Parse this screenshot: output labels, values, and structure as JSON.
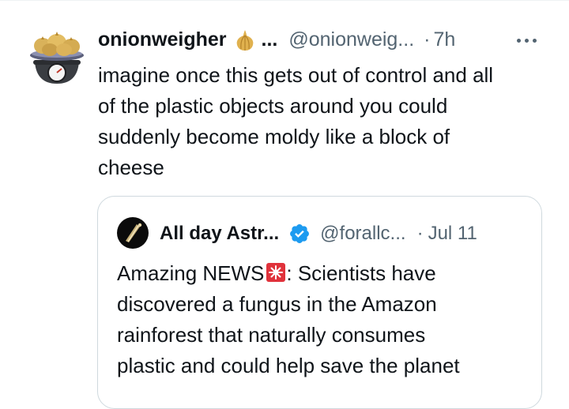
{
  "tweet": {
    "display_name": "onionweigher",
    "name_truncation": "...",
    "handle": "@onionweig...",
    "separator": "·",
    "timestamp": "7h",
    "text_lines": [
      "imagine once this gets out of control and all",
      "of the plastic objects around you could",
      "suddenly become moldy like a block of",
      "cheese"
    ],
    "avatar_icon": "onion-scale-icon",
    "name_badge_icon": "onion-icon",
    "more_icon": "more-horizontal-icon"
  },
  "quote": {
    "display_name": "All day Astr...",
    "handle": "@forallc...",
    "separator": "·",
    "date": "Jul 11",
    "text_first_part": "Amazing NEWS",
    "text_after_icon": ": Scientists have",
    "text_lines": [
      "discovered a fungus in the Amazon",
      "rainforest that naturally consumes",
      "plastic and could help save the planet"
    ],
    "avatar_icon": "telescope-avatar-icon",
    "verified_icon": "verified-badge-icon",
    "inline_icon": "siren-icon"
  },
  "colors": {
    "text_primary": "#0f1419",
    "text_secondary": "#536471",
    "verified_blue": "#1d9bf0",
    "border": "#cfd9de"
  }
}
